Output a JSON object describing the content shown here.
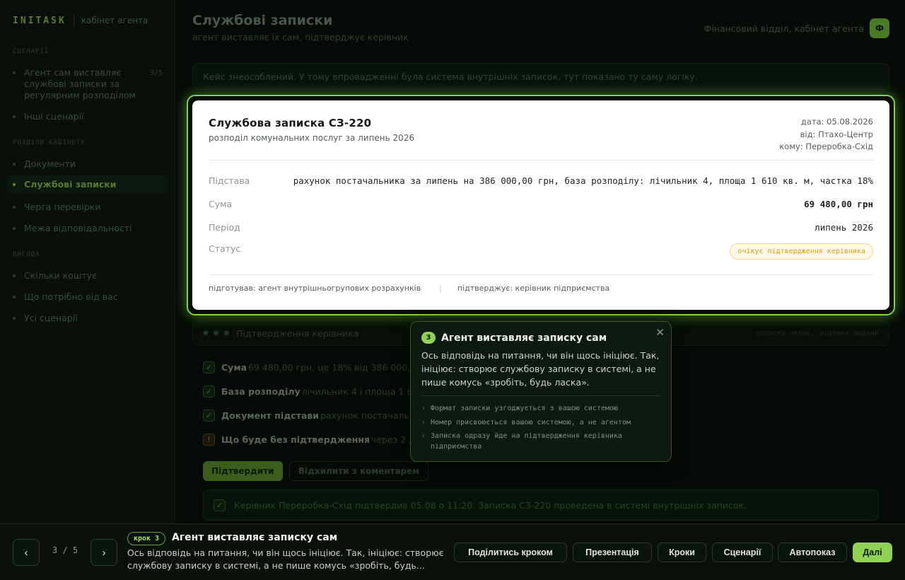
{
  "app": {
    "brand": "INITASK",
    "brand_sub": "кабінет агента"
  },
  "sidebar": {
    "sections": [
      {
        "title": "СЦЕНАРІЇ"
      },
      {
        "title": "РОЗДІЛИ КАБІНЕТУ"
      },
      {
        "title": "ВИГОДА"
      }
    ],
    "scenarios": [
      {
        "label": "Агент сам виставляє службові записки за регулярним розподілом",
        "count": "3/5"
      },
      {
        "label": "Інші сценарії"
      }
    ],
    "cabinet": [
      {
        "label": "Документи"
      },
      {
        "label": "Службові записки"
      },
      {
        "label": "Черга перевірки"
      },
      {
        "label": "Межа відповідальності"
      }
    ],
    "benefit": [
      {
        "label": "Скільки коштує"
      },
      {
        "label": "Що потрібно від вас"
      },
      {
        "label": "Усі сценарії"
      }
    ]
  },
  "header": {
    "title": "Службові записки",
    "subtitle": "агент виставляє їх сам, підтверджує керівник",
    "department": "Фінансовий відділ, кабінет агента",
    "avatar": "Ф"
  },
  "notice": "Кейс знеособлений. У тому впровадженні була система внутрішніх записок, тут показано ту саму логіку.",
  "memo": {
    "title": "Службова записка СЗ-220",
    "subtitle": "розподіл комунальних послуг за липень 2026",
    "date": "дата: 05.08.2026",
    "from": "від: Птахо-Центр",
    "to": "кому: Переробка-Схід",
    "rows": [
      {
        "key": "Підстава",
        "value": "рахунок постачальника за липень на 386 000,00 грн, база розподілу: лічильник 4, площа 1 610 кв. м, частка 18%"
      },
      {
        "key": "Сума",
        "value": "69 480,00 грн"
      },
      {
        "key": "Період",
        "value": "липень 2026"
      },
      {
        "key": "Статус",
        "value": "очікує підтвердження керівника"
      }
    ],
    "prepared_by": "підготував: агент внутрішньогрупових розрахунків",
    "confirmed_by": "підтверджує: керівник підприємства"
  },
  "approval": {
    "dots": "● ● ●",
    "title": "Підтвердження керівника",
    "right": "записка чекає, рішення людини",
    "items": [
      {
        "label": "Сума",
        "detail": "69 480,00 грн, це 18% від 386 000,00 грн"
      },
      {
        "label": "База розподілу",
        "detail": "лічильник 4 і площа 1 610 кв. м"
      },
      {
        "label": "Документ підстави",
        "detail": "рахунок постачальника"
      },
      {
        "label": "Що буде без підтвердження",
        "detail": "через 2 дні записка піде у фінансовий відділ"
      }
    ],
    "approve": "Підтвердити",
    "reject": "Відхилити з коментарем",
    "confirmation": "Керівник Переробка-Схід підтвердив 05.08 о 11:20. Записка СЗ-220 проведена в системі внутрішніх записок."
  },
  "tooltip": {
    "number": "3",
    "title": "Агент виставляє записку сам",
    "body": "Ось відповідь на питання, чи він щось ініціює. Так, ініціює: створює службову записку в системі, а не пише комусь «зробіть, будь ласка».",
    "points": [
      "Формат записки узгоджується з вашою системою",
      "Номер присвоюється вашою системою, а не агентом",
      "Записка одразу йде на підтвердження керівника підприємства"
    ]
  },
  "bottom_bar": {
    "counter": "3 / 5",
    "step_badge": "крок 3",
    "step_title": "Агент виставляє записку сам",
    "step_desc": "Ось відповідь на питання, чи він щось ініціює. Так, ініціює: створює службову записку в системі, а не пише комусь «зробіть, будь...",
    "buttons": {
      "share": "Поділитись кроком",
      "presentation": "Презентація",
      "steps": "Кроки",
      "scenarios": "Сценарії",
      "autoplay": "Автопоказ",
      "next": "Далі"
    }
  },
  "colors": {
    "accent": "#8fd255",
    "highlight_border": "#7bd34c",
    "status_pending": "#d3a017"
  }
}
